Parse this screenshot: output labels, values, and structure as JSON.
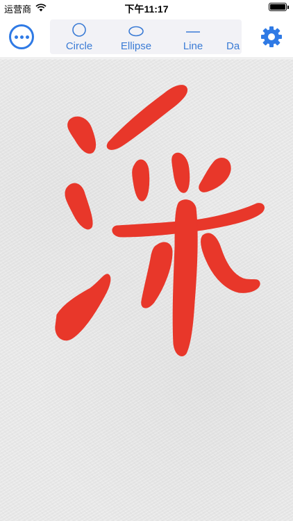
{
  "status_bar": {
    "carrier": "运营商",
    "time": "下午11:17",
    "battery_level": 1.0
  },
  "toolbar": {
    "more_icon": "ellipsis-circle-icon",
    "settings_icon": "gear-icon",
    "shapes": [
      {
        "label": "Circle",
        "icon": "circle-icon"
      },
      {
        "label": "Ellipse",
        "icon": "ellipse-icon"
      },
      {
        "label": "Line",
        "icon": "line-icon"
      },
      {
        "label": "Da",
        "icon": ""
      }
    ]
  },
  "colors": {
    "accent": "#2f7ae5",
    "ink": "#e8372a",
    "paper": "#e7e7e7"
  }
}
